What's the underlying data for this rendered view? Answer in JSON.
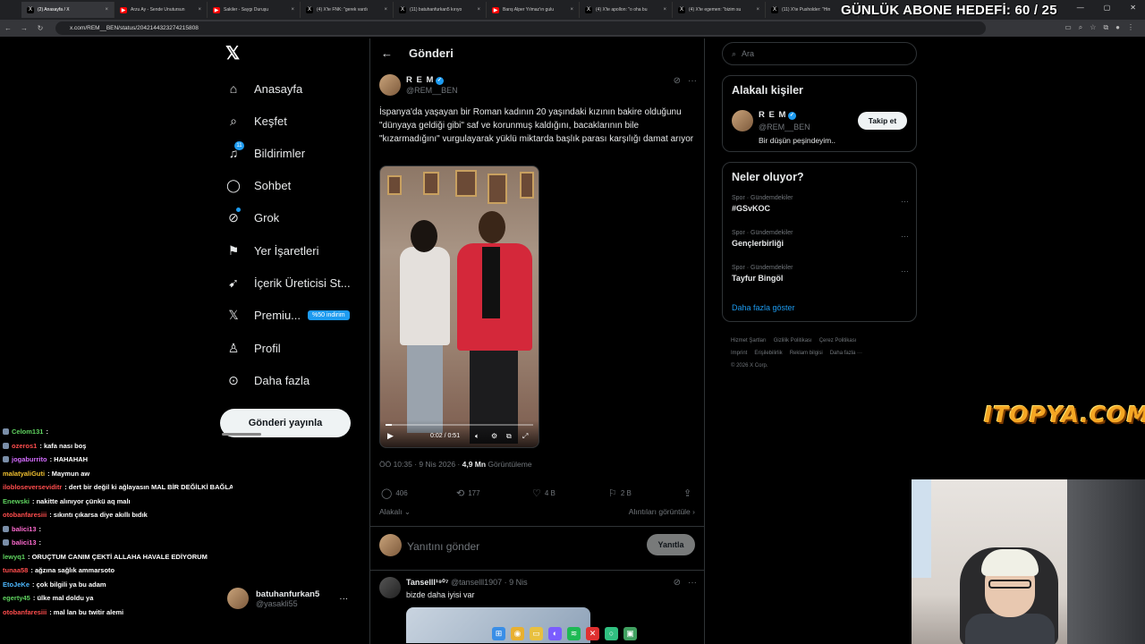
{
  "browser": {
    "tabs": [
      {
        "label": "(2) Anasayfa / X",
        "icon": "x-icon",
        "color": "#000000"
      },
      {
        "label": "Arzu Ay - Sende Unutursun",
        "icon": "youtube-icon",
        "color": "#ff0000"
      },
      {
        "label": "Sakiler - Saygı Duruşu",
        "icon": "youtube-icon",
        "color": "#ff0000"
      },
      {
        "label": "(4) X'te FNK: \"gerek vardı",
        "icon": "x-icon",
        "color": "#000000"
      },
      {
        "label": "(11) batuhanfurkan5 kırıyo",
        "icon": "x-icon",
        "color": "#000000"
      },
      {
        "label": "Barış Alper Yılmaz'ın gulu",
        "icon": "youtube-icon",
        "color": "#ff0000"
      },
      {
        "label": "(4) X'te apollon: \"o oha bu",
        "icon": "x-icon",
        "color": "#000000"
      },
      {
        "label": "(4) X'te egemen: \"bizim su",
        "icon": "x-icon",
        "color": "#000000"
      },
      {
        "label": "(11) X'te Pusholder: \"Hin",
        "icon": "x-icon",
        "color": "#000000"
      }
    ],
    "url": "x.com/REM__BEN/status/2042144323274215808",
    "goal_overlay": "GÜNLÜK ABONE HEDEFİ: 60 / 25"
  },
  "nav": {
    "logo": "𝕏",
    "items": [
      {
        "label": "Anasayfa",
        "icon": "⌂",
        "name": "home"
      },
      {
        "label": "Keşfet",
        "icon": "⌕",
        "name": "explore"
      },
      {
        "label": "Bildirimler",
        "icon": "♫",
        "name": "notifications",
        "badge": "11"
      },
      {
        "label": "Sohbet",
        "icon": "◯",
        "name": "chat"
      },
      {
        "label": "Grok",
        "icon": "⊘",
        "name": "grok"
      },
      {
        "label": "Yer İşaretleri",
        "icon": "⚑",
        "name": "bookmarks"
      },
      {
        "label": "İçerik Üreticisi St...",
        "icon": "➹",
        "name": "creator-studio"
      },
      {
        "label": "Premiu...",
        "icon": "𝕏",
        "name": "premium",
        "promo": "%50 indirim"
      },
      {
        "label": "Profil",
        "icon": "♙",
        "name": "profile"
      },
      {
        "label": "Daha fazla",
        "icon": "⊙",
        "name": "more"
      }
    ],
    "post_button": "Gönderi yayınla",
    "account": {
      "name": "batuhanfurkan5",
      "handle": "@yasakli55"
    }
  },
  "main": {
    "title": "Gönderi",
    "author": {
      "name": "R E M",
      "handle": "@REM__BEN"
    },
    "text": "İspanya'da yaşayan bir Roman kadının 20 yaşındaki kızının bakire olduğunu \"dünyaya geldiği gibi\" saf ve korunmuş kaldığını, bacaklarının bile \"kızarmadığını\" vurgulayarak yüklü miktarda başlık parası karşılığı damat arıyor",
    "video": {
      "time": "0:02 / 0:51",
      "progress": 0.04
    },
    "meta": {
      "time": "ÖÖ 10:35 · 9 Nis 2026 · ",
      "views": "4,9 Mn",
      "views_label": " Görüntüleme"
    },
    "actions": {
      "replies": "406",
      "reposts": "177",
      "likes": "4 B",
      "bookmarks": "2 B"
    },
    "sort_label": "Alakalı",
    "quotes_label": "Alıntıları görüntüle",
    "reply_placeholder": "Yanıtını gönder",
    "reply_button": "Yanıtla",
    "first_reply": {
      "name": "Tanselll¹⁹⁰⁷",
      "handle": "@tanselll1907 · 9 Nis",
      "text": "bizde daha iyisi var"
    }
  },
  "sidebar": {
    "search_placeholder": "Ara",
    "related_title": "Alakalı kişiler",
    "related": {
      "name": "R E M",
      "handle": "@REM__BEN",
      "bio": "Bir düşün peşindeyim..",
      "follow": "Takip et"
    },
    "trends_title": "Neler oluyor?",
    "trends": [
      {
        "category": "Spor · Gündemdekiler",
        "name": "#GSvKOC"
      },
      {
        "category": "Spor · Gündemdekiler",
        "name": "Gençlerbirliği"
      },
      {
        "category": "Spor · Gündemdekiler",
        "name": "Tayfur Bingöl"
      }
    ],
    "show_more": "Daha fazla göster",
    "footer": [
      "Hizmet Şartları",
      "Gizlilik Politikası",
      "Çerez Politikası",
      "Imprint",
      "Erişilebilirlik",
      "Reklam bilgisi",
      "Daha fazla ···",
      "© 2026 X Corp."
    ]
  },
  "chat": [
    {
      "user": "Celom131",
      "color": "#5fd35f",
      "msg": ":",
      "badge": true
    },
    {
      "user": "ozeros1",
      "color": "#ff4d4d",
      "msg": ": kafa nası boş",
      "badge": true
    },
    {
      "user": "jogaburrito",
      "color": "#d46cff",
      "msg": ": HAHAHAH",
      "badge": true
    },
    {
      "user": "malatyaliGuti",
      "color": "#f0c030",
      "msg": ": Maymun aw",
      "badge": false
    },
    {
      "user": "ilobloseverseviditr",
      "color": "#ff4d4d",
      "msg": ": dert bir değil ki ağlayasın MAL BİR DEĞİLKİ BAĞLAYASIN",
      "badge": false
    },
    {
      "user": "Enewski",
      "color": "#5fd35f",
      "msg": ": nakitte alınıyor çünkü aq malı",
      "badge": false
    },
    {
      "user": "otobanfaresiii",
      "color": "#ff4d4d",
      "msg": ": sıkıntı çıkarsa diye akıllı bıdık",
      "badge": false
    },
    {
      "user": "balici13",
      "color": "#ff6bd0",
      "msg": ":",
      "badge": true
    },
    {
      "user": "balici13",
      "color": "#ff6bd0",
      "msg": ":",
      "badge": true
    },
    {
      "user": "lewyq1",
      "color": "#5fd35f",
      "msg": ": ORUÇTUM CANIM ÇEKTİ ALLAHA HAVALE EDİYORUM",
      "badge": false
    },
    {
      "user": "tunaa58",
      "color": "#ff4d4d",
      "msg": ": ağzına sağlık ammarsoto",
      "badge": false
    },
    {
      "user": "EtoJeKe",
      "color": "#4db8ff",
      "msg": ": çok bilgili ya bu adam",
      "badge": false
    },
    {
      "user": "egerty45",
      "color": "#5fd35f",
      "msg": ": ülke mal doldu ya",
      "badge": false
    },
    {
      "user": "otobanfaresiii",
      "color": "#ff4d4d",
      "msg": ": mal lan bu twitir alemi",
      "badge": false
    }
  ],
  "logo_text": "ITOPYA.COM"
}
